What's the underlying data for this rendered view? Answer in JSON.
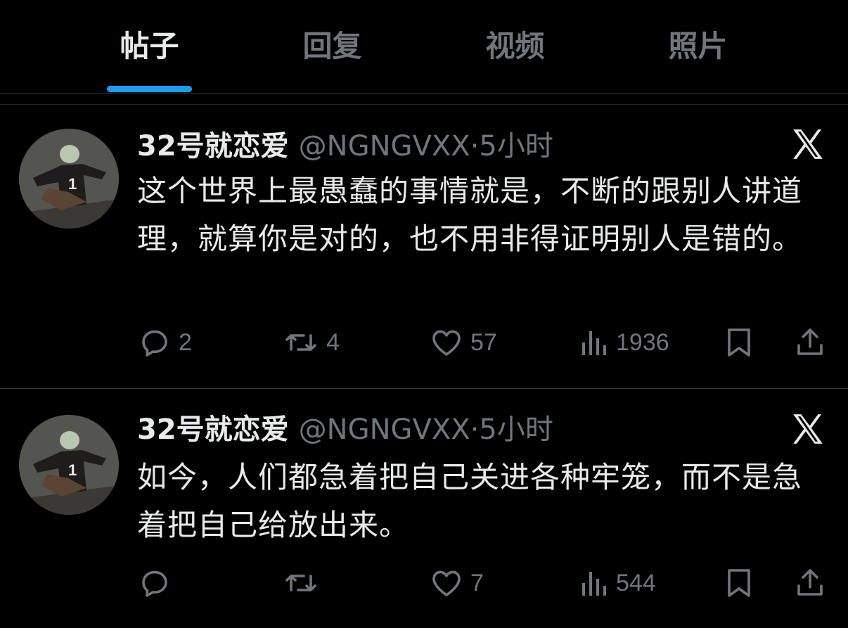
{
  "tabs": [
    {
      "label": "帖子",
      "active": true
    },
    {
      "label": "回复",
      "active": false
    },
    {
      "label": "视频",
      "active": false
    },
    {
      "label": "照片",
      "active": false
    }
  ],
  "accent_color": "#1d9bf0",
  "posts": [
    {
      "display_name": "32号就恋爱",
      "handle": "@NGNGVXX·5小时",
      "text": "这个世界上最愚蠢的事情就是，不断的跟别人讲道理，就算你是对的，也不用非得证明别人是错的。",
      "counts": {
        "reply": "2",
        "repost": "4",
        "like": "57",
        "views": "1936"
      }
    },
    {
      "display_name": "32号就恋爱",
      "handle": "@NGNGVXX·5小时",
      "text": "如今，人们都急着把自己关进各种牢笼，而不是急着把自己给放出来。",
      "counts": {
        "reply": "",
        "repost": "",
        "like": "7",
        "views": "544"
      }
    }
  ],
  "icons": [
    "reply-icon",
    "repost-icon",
    "like-icon",
    "views-icon",
    "bookmark-icon",
    "share-icon",
    "x-logo-icon"
  ]
}
